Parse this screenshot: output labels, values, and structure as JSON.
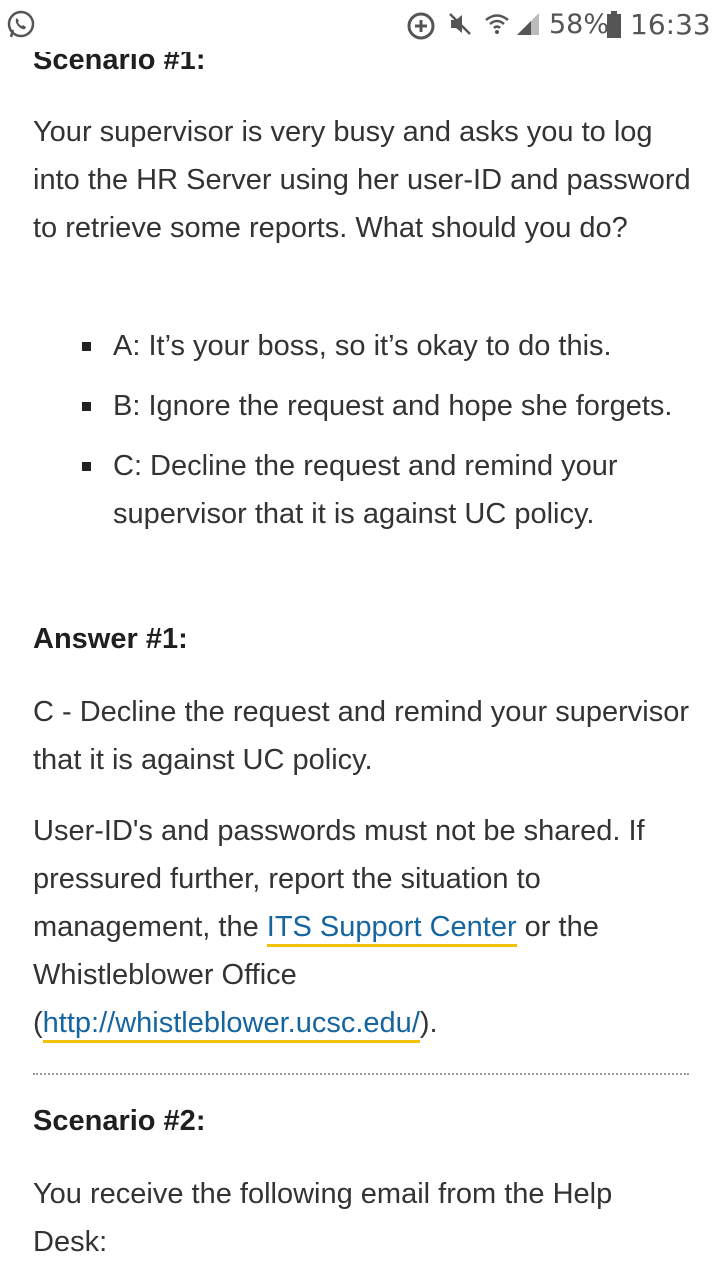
{
  "status_bar": {
    "icons": [
      "whatsapp-icon",
      "add-circle-icon",
      "mute-icon",
      "wifi-icon",
      "signal-icon",
      "battery-icon"
    ],
    "battery": "58%",
    "time": "16:33"
  },
  "scenario1": {
    "heading": "Scenario #1:",
    "question": "Your supervisor is very busy and asks you to log into the HR Server using her user-ID and password to retrieve some reports. What should you do?",
    "options": [
      "A: It’s your boss, so it’s okay to do this.",
      "B: Ignore the request and hope she forgets.",
      "C: Decline the request and remind your supervisor that it is against UC policy."
    ]
  },
  "answer1": {
    "heading": "Answer #1:",
    "answer": "C - Decline the request and remind your supervisor that it is against UC policy.",
    "explanation_before": "User-ID's and passwords must not be shared. If pressured further, report the situation to management, the ",
    "link1": "ITS Support Center",
    "explanation_middle": " or the Whistleblower Office (",
    "link2": "http://whistleblower.ucsc.edu/",
    "explanation_after": ")."
  },
  "scenario2": {
    "heading": "Scenario #2:",
    "intro": "You receive the following email from the Help Desk:"
  },
  "colors": {
    "link": "#1565a0",
    "link_underline": "#f2c200"
  }
}
